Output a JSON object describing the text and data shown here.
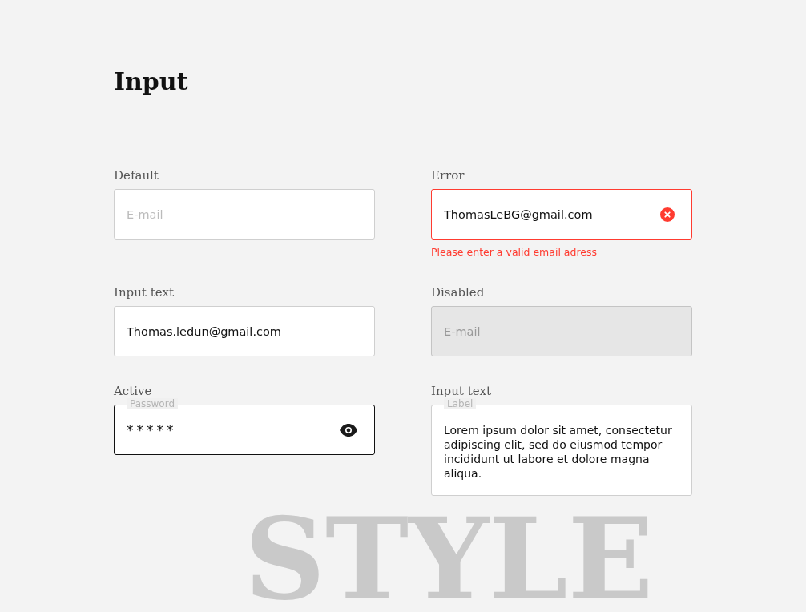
{
  "title": "Input",
  "backdrop_word": "STYLE",
  "fields": [
    {
      "label": "Default",
      "kind": "input",
      "error": false,
      "disabled": false,
      "focused": false,
      "placeholder": "E-mail"
    },
    {
      "label": "Error",
      "kind": "input",
      "error": true,
      "disabled": false,
      "focused": false,
      "value": "ThomasLeBG@gmail.com",
      "error_message": "Please enter a valid email adress"
    },
    {
      "label": "Input text",
      "kind": "input",
      "error": false,
      "disabled": false,
      "focused": false,
      "value": "Thomas.ledun@gmail.com"
    },
    {
      "label": "Disabled",
      "kind": "input",
      "error": false,
      "disabled": true,
      "focused": false,
      "placeholder": "E-mail"
    },
    {
      "label": "Active",
      "kind": "password",
      "error": false,
      "disabled": false,
      "focused": true,
      "floating_label": "Password",
      "value": "*****"
    },
    {
      "label": "Input text",
      "kind": "textarea",
      "error": false,
      "disabled": false,
      "focused": false,
      "floating_label": "Label",
      "value": "Lorem ipsum dolor sit amet, consectetur adipiscing elit, sed do eiusmod tempor incididunt ut labore et dolore magna aliqua."
    }
  ]
}
